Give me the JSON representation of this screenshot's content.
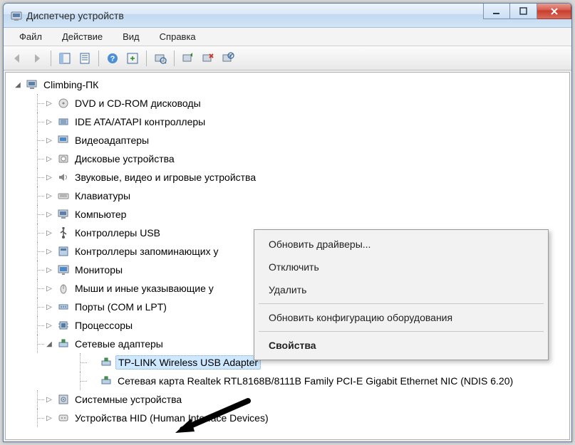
{
  "window": {
    "title": "Диспетчер устройств"
  },
  "menu": {
    "file": "Файл",
    "action": "Действие",
    "view": "Вид",
    "help": "Справка"
  },
  "tree": {
    "root": "Climbing-ПК",
    "items": [
      "DVD и CD-ROM дисководы",
      "IDE ATA/ATAPI контроллеры",
      "Видеоадаптеры",
      "Дисковые устройства",
      "Звуковые, видео и игровые устройства",
      "Клавиатуры",
      "Компьютер",
      "Контроллеры USB",
      "Контроллеры запоминающих у",
      "Мониторы",
      "Мыши и иные указывающие у",
      "Порты (COM и LPT)",
      "Процессоры",
      "Сетевые адаптеры",
      "Системные устройства",
      "Устройства HID (Human Interface Devices)"
    ],
    "network_children": [
      "TP-LINK Wireless USB Adapter",
      "Сетевая карта Realtek RTL8168B/8111B Family PCI-E Gigabit Ethernet NIC (NDIS 6.20)"
    ]
  },
  "context_menu": {
    "update": "Обновить драйверы...",
    "disable": "Отключить",
    "remove": "Удалить",
    "scan": "Обновить конфигурацию оборудования",
    "properties": "Свойства"
  }
}
